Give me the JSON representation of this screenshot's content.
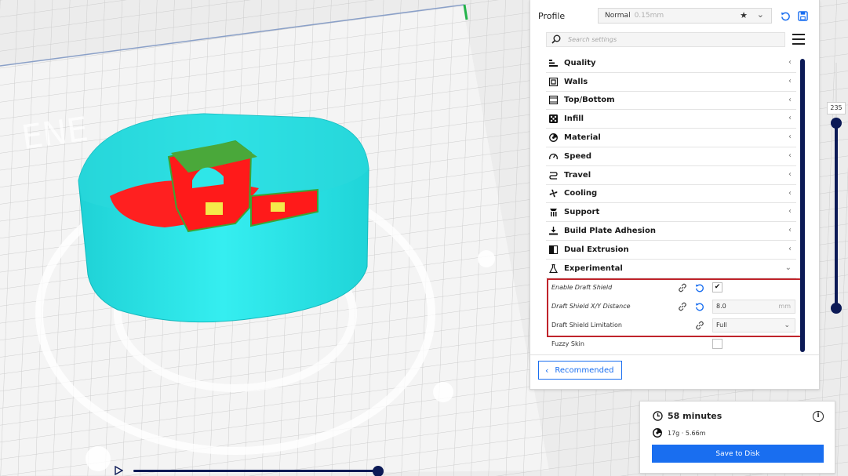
{
  "profile": {
    "label": "Profile",
    "selected": "Normal",
    "layer_height": "0.15mm"
  },
  "search": {
    "placeholder": "Search settings"
  },
  "categories": [
    {
      "label": "Quality",
      "icon": "quality-icon"
    },
    {
      "label": "Walls",
      "icon": "walls-icon"
    },
    {
      "label": "Top/Bottom",
      "icon": "top-bottom-icon"
    },
    {
      "label": "Infill",
      "icon": "infill-icon"
    },
    {
      "label": "Material",
      "icon": "material-icon"
    },
    {
      "label": "Speed",
      "icon": "speed-icon"
    },
    {
      "label": "Travel",
      "icon": "travel-icon"
    },
    {
      "label": "Cooling",
      "icon": "cooling-icon"
    },
    {
      "label": "Support",
      "icon": "support-icon"
    },
    {
      "label": "Build Plate Adhesion",
      "icon": "build-plate-icon"
    },
    {
      "label": "Dual Extrusion",
      "icon": "dual-extrusion-icon"
    },
    {
      "label": "Experimental",
      "icon": "experimental-icon"
    }
  ],
  "experimental_settings": {
    "enable_draft_shield": {
      "label": "Enable Draft Shield",
      "checked": true,
      "check_glyph": "✔"
    },
    "draft_shield_distance": {
      "label": "Draft Shield X/Y Distance",
      "value": "8.0",
      "unit": "mm"
    },
    "draft_shield_limitation": {
      "label": "Draft Shield Limitation",
      "value": "Full"
    },
    "fuzzy_skin": {
      "label": "Fuzzy Skin",
      "checked": false
    }
  },
  "recommended_button": {
    "label": "Recommended"
  },
  "layer_slider": {
    "value": "235"
  },
  "print_info": {
    "time": "58 minutes",
    "material": "17g · 5.66m",
    "save_label": "Save to Disk"
  },
  "colors": {
    "accent": "#196ef0",
    "slider": "#0c1a56",
    "highlight": "#c0242b",
    "shell": "#2ee6e8",
    "model": "#ff1a1a",
    "infill": "#f5e94a",
    "walls": "#6ac13c"
  }
}
